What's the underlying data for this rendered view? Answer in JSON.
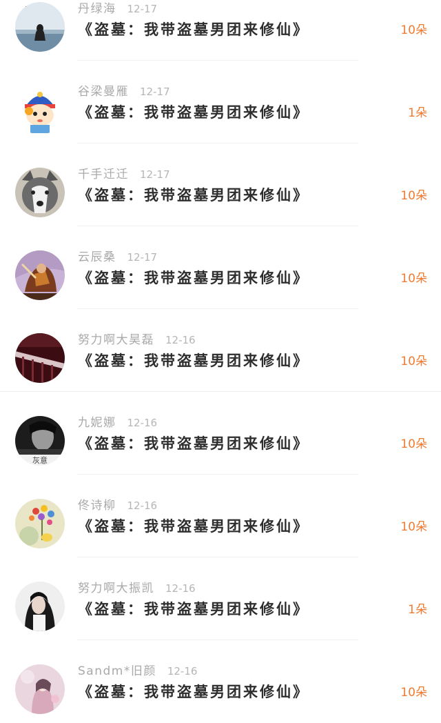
{
  "items": [
    {
      "name": "丹绿海",
      "date": "12-17",
      "book": "《盗墓：我带盗墓男团来修仙》",
      "amount": "10朵",
      "avatar": "lake-silhouette-avatar"
    },
    {
      "name": "谷梁曼雁",
      "date": "12-17",
      "book": "《盗墓：我带盗墓男团来修仙》",
      "amount": "1朵",
      "avatar": "cartoon-official-avatar"
    },
    {
      "name": "千手迁迁",
      "date": "12-17",
      "book": "《盗墓：我带盗墓男团来修仙》",
      "amount": "10朵",
      "avatar": "husky-dog-avatar"
    },
    {
      "name": "云辰桑",
      "date": "12-17",
      "book": "《盗墓：我带盗墓男团来修仙》",
      "amount": "10朵",
      "avatar": "warrior-art-avatar"
    },
    {
      "name": "努力啊大昊磊",
      "date": "12-16",
      "book": "《盗墓：我带盗墓男团来修仙》",
      "amount": "10朵",
      "avatar": "dark-red-railing-avatar"
    },
    {
      "name": "九妮娜",
      "date": "12-16",
      "book": "《盗墓：我带盗墓男团来修仙》",
      "amount": "10朵",
      "avatar": "bw-portrait-avatar",
      "avatar_caption": "灰意"
    },
    {
      "name": "佟诗柳",
      "date": "12-16",
      "book": "《盗墓：我带盗墓男团来修仙》",
      "amount": "10朵",
      "avatar": "flower-bokeh-avatar"
    },
    {
      "name": "努力啊大振凯",
      "date": "12-16",
      "book": "《盗墓：我带盗墓男团来修仙》",
      "amount": "1朵",
      "avatar": "girl-portrait-avatar"
    },
    {
      "name": "Sandm*旧颜",
      "date": "12-16",
      "book": "《盗墓：我带盗墓男团来修仙》",
      "amount": "10朵",
      "avatar": "pink-illustration-avatar"
    }
  ],
  "colors": {
    "amount": "#f07a2f",
    "name": "#a9a9a9",
    "title": "#2d2d2d"
  }
}
